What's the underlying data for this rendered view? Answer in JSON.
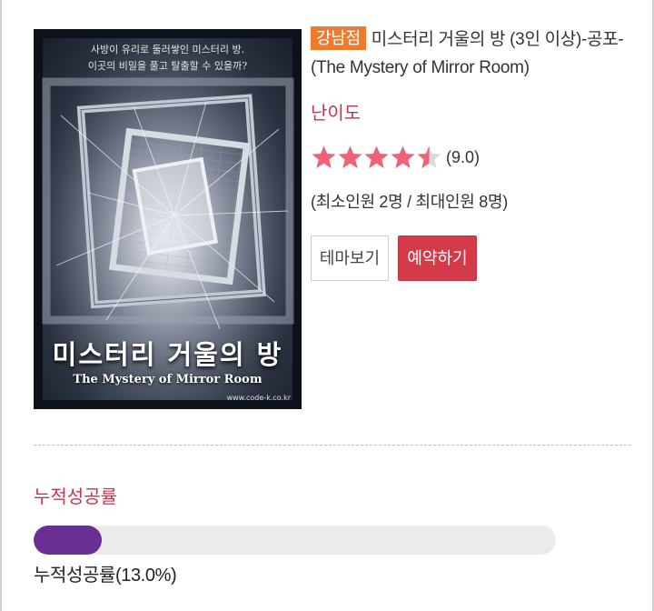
{
  "poster": {
    "tagline_line1": "사방이 유리로 둘러쌓인 미스터리 방.",
    "tagline_line2": "이곳의 비밀을 풀고 탈출할 수 있을까?",
    "title_ko": "미스터리 거울의 방",
    "title_en": "The Mystery of Mirror Room",
    "url": "www.code-k.co.kr"
  },
  "theme": {
    "branch": "강남점",
    "title": "미스터리 거울의 방 (3인 이상)-공포- (The Mystery of Mirror Room)",
    "difficulty_label": "난이도",
    "rating_value": 4.5,
    "rating_max": 5,
    "rating_text": "(9.0)",
    "capacity": "(최소인원 2명 / 최대인원 8명)"
  },
  "buttons": {
    "view_theme": "테마보기",
    "reserve": "예약하기"
  },
  "success": {
    "heading": "누적성공률",
    "rate_percent": 13.0,
    "caption": "누적성공률(13.0%)"
  },
  "colors": {
    "branch_badge": "#f07b2e",
    "accent_red": "#c8344b",
    "reserve_button": "#d33b48",
    "star": "#f06275",
    "star_empty": "#d9d9d9",
    "progress_fill": "#6a2f93",
    "progress_track": "#ebebeb"
  }
}
